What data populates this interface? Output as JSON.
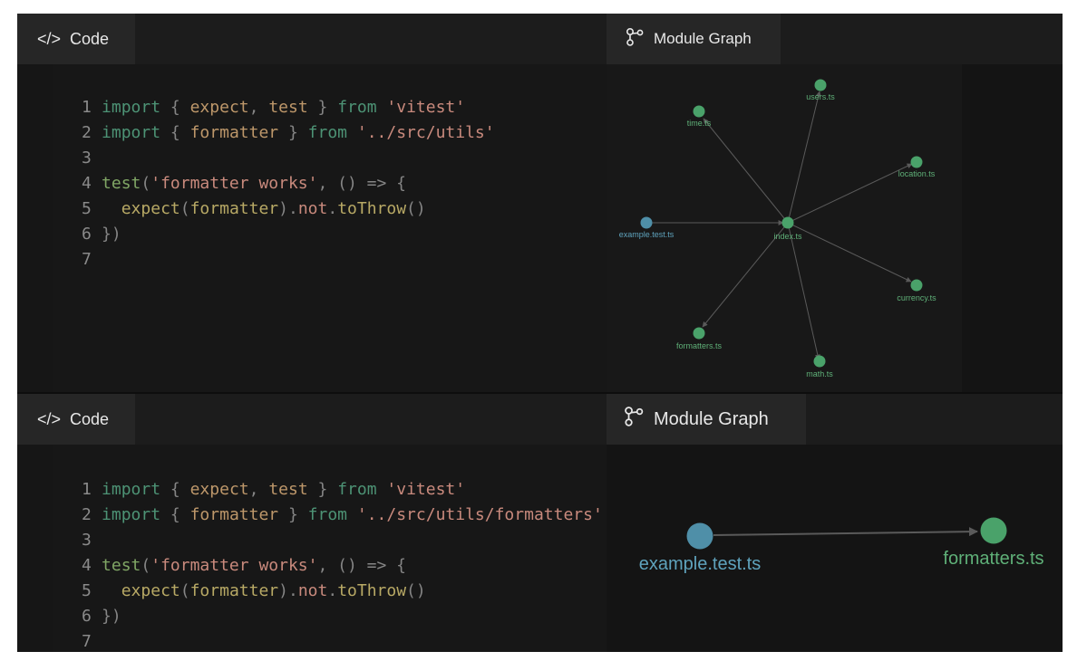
{
  "top": {
    "code_tab": {
      "icon": "code-icon",
      "glyph": "</>",
      "label": "Code"
    },
    "graph_tab": {
      "icon": "module-graph-icon",
      "label": "Module Graph"
    },
    "code_lines": [
      "1",
      "2",
      "3",
      "4",
      "5",
      "6",
      "7"
    ],
    "code": {
      "l1": {
        "import": "import",
        "brace_open": "{",
        "expect": "expect",
        "comma": ",",
        "test": "test",
        "brace_close": "}",
        "from": "from",
        "module": "'vitest'"
      },
      "l2": {
        "import": "import",
        "brace_open": "{",
        "formatter": "formatter",
        "brace_close": "}",
        "from": "from",
        "module": "'../src/utils'"
      },
      "l4": {
        "test": "test",
        "paren": "(",
        "name": "'formatter works'",
        "comma": ",",
        "arrow": "() => {"
      },
      "l5": {
        "expect": "expect",
        "open": "(",
        "formatter": "formatter",
        "close": ")",
        "dot1": ".",
        "not": "not",
        "dot2": ".",
        "toThrow": "toThrow",
        "call": "()"
      },
      "l6": {
        "close": "})"
      }
    },
    "graph": {
      "nodes": [
        "users.ts",
        "time.ts",
        "location.ts",
        "example.test.ts",
        "index.ts",
        "currency.ts",
        "formatters.ts",
        "math.ts"
      ]
    }
  },
  "bottom": {
    "code_tab": {
      "icon": "code-icon",
      "glyph": "</>",
      "label": "Code"
    },
    "graph_tab": {
      "icon": "module-graph-icon",
      "label": "Module Graph"
    },
    "code_lines": [
      "1",
      "2",
      "3",
      "4",
      "5",
      "6",
      "7"
    ],
    "code": {
      "l1": {
        "import": "import",
        "brace_open": "{",
        "expect": "expect",
        "comma": ",",
        "test": "test",
        "brace_close": "}",
        "from": "from",
        "module": "'vitest'"
      },
      "l2": {
        "import": "import",
        "brace_open": "{",
        "formatter": "formatter",
        "brace_close": "}",
        "from": "from",
        "module": "'../src/utils/formatters'"
      },
      "l4": {
        "test": "test",
        "paren": "(",
        "name": "'formatter works'",
        "comma": ",",
        "arrow": "() => {"
      },
      "l5": {
        "expect": "expect",
        "open": "(",
        "formatter": "formatter",
        "close": ")",
        "dot1": ".",
        "not": "not",
        "dot2": ".",
        "toThrow": "toThrow",
        "call": "()"
      },
      "l6": {
        "close": "})"
      }
    },
    "graph": {
      "nodes": [
        "example.test.ts",
        "formatters.ts"
      ]
    }
  },
  "colors": {
    "test_node": "#4f8fa8",
    "module_node": "#4aa26a",
    "edge": "#5a5a5a",
    "background": "#131313"
  }
}
